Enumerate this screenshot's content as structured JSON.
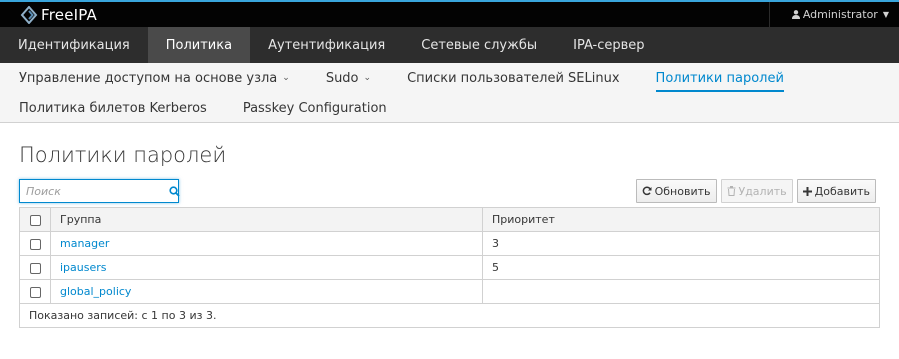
{
  "brand": {
    "name": "FreeIPA"
  },
  "user": {
    "name": "Administrator"
  },
  "primary_nav": [
    {
      "label": "Идентификация"
    },
    {
      "label": "Политика"
    },
    {
      "label": "Аутентификация"
    },
    {
      "label": "Сетевые службы"
    },
    {
      "label": "IPA-сервер"
    }
  ],
  "secondary_nav": [
    {
      "label": "Управление доступом на основе узла"
    },
    {
      "label": "Sudo"
    },
    {
      "label": "Списки пользователей SELinux"
    },
    {
      "label": "Политики паролей"
    },
    {
      "label": "Политика билетов Kerberos"
    },
    {
      "label": "Passkey Configuration"
    }
  ],
  "page": {
    "title": "Политики паролей"
  },
  "search": {
    "placeholder": "Поиск",
    "value": ""
  },
  "toolbar": {
    "refresh_label": "Обновить",
    "delete_label": "Удалить",
    "add_label": "Добавить"
  },
  "table": {
    "columns": [
      "Группа",
      "Приоритет"
    ],
    "rows": [
      {
        "group": "manager",
        "priority": "3"
      },
      {
        "group": "ipausers",
        "priority": "5"
      },
      {
        "group": "global_policy",
        "priority": ""
      }
    ],
    "footer": "Показано записей: с 1 по 3 из 3."
  },
  "colors": {
    "accent": "#0088ce",
    "topbar": "#030303",
    "nav": "#2d2d2d"
  }
}
